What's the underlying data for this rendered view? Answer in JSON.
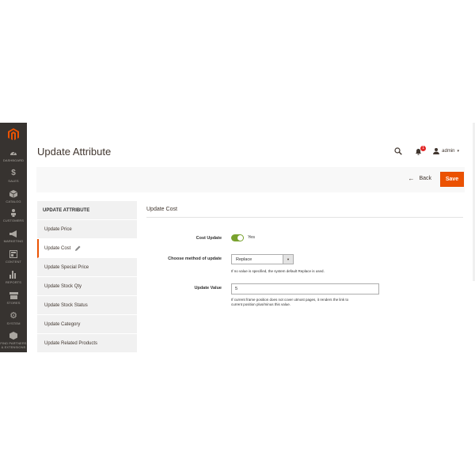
{
  "page_title": "Update Attribute",
  "sidebar": {
    "items": [
      {
        "label": "DASHBOARD",
        "icon": "dashboard-icon"
      },
      {
        "label": "SALES",
        "icon": "dollar-icon"
      },
      {
        "label": "CATALOG",
        "icon": "cube-icon"
      },
      {
        "label": "CUSTOMERS",
        "icon": "user-icon"
      },
      {
        "label": "MARKETING",
        "icon": "megaphone-icon"
      },
      {
        "label": "CONTENT",
        "icon": "layout-icon"
      },
      {
        "label": "REPORTS",
        "icon": "bar-chart-icon"
      },
      {
        "label": "STORES",
        "icon": "store-icon"
      },
      {
        "label": "SYSTEM",
        "icon": "gear-icon"
      },
      {
        "label": "FIND PARTNERS & EXTENSIONS",
        "icon": "box-icon"
      }
    ]
  },
  "header": {
    "notification_count": "1",
    "user": "admin",
    "caret": "▾"
  },
  "actions": {
    "back": "Back",
    "back_arrow": "←",
    "save": "Save"
  },
  "tabs": {
    "heading": "UPDATE ATTRIBUTE",
    "items": [
      {
        "label": "Update Price"
      },
      {
        "label": "Update Cost"
      },
      {
        "label": "Update Special Price"
      },
      {
        "label": "Update Stock Qty"
      },
      {
        "label": "Update Stock Status"
      },
      {
        "label": "Update Category"
      },
      {
        "label": "Update Related Products"
      }
    ],
    "active_index": 1
  },
  "form": {
    "section_title": "Update Cost",
    "cost_update": {
      "label": "Cost Update",
      "value": "Yes",
      "enabled": true
    },
    "method": {
      "label": "Choose method of update",
      "selected": "Replace",
      "note": "If no value is specified, the system default Replace is used."
    },
    "update_value": {
      "label": "Update Value",
      "value": "5",
      "note_line1": "If current frame position does not cover utmost pages, it renders the link to",
      "note_line2": "current position plus/minus this value."
    }
  },
  "colors": {
    "sidebar_bg": "#373330",
    "accent": "#eb5202",
    "toggle_on": "#79a22e"
  }
}
